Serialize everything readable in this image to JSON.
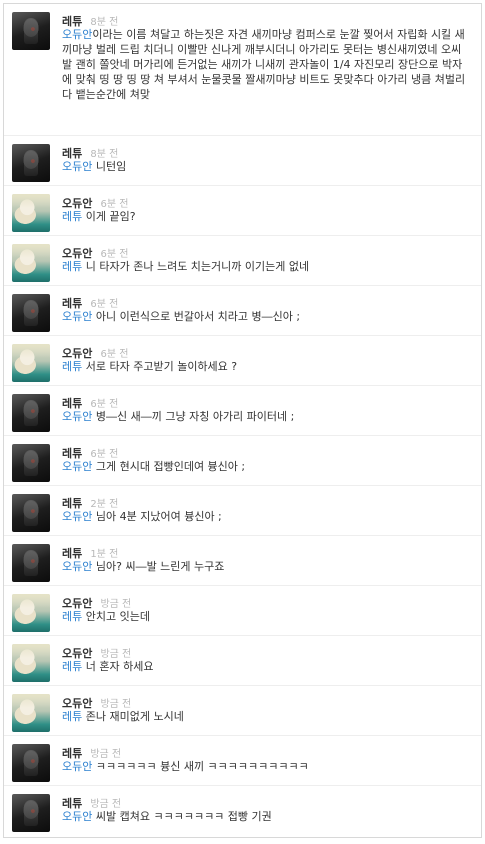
{
  "colors": {
    "mention": "#2a7fcf",
    "time": "#b8b8b8",
    "author": "#333333"
  },
  "comments": [
    {
      "author": "레튜",
      "time": "8분 전",
      "mention": "오듀안",
      "text": "이라는 이름 쳐달고 하는짓은 자견 새끼마냥 컴퍼스로 눈깔 찢어서 자립화 시킬 새끼마냥 벌레 드립 치더니 이빨만 신나게 깨부시더니 아가리도 못터는 병신새끼였네 오씨발 괜히 쫄앗네 머가리에 든거없는 새끼가 니새끼 관자놀이 1/4 자진모리 장단으로 박자에 맞춰 띵 땅 띵 땅 쳐 부셔서 눈물콧물 짤새끼마냥 비트도 못맞추다 아가리 냉큼 쳐벌리다 뱉는순간에 쳐맞",
      "avatar": "dark-avatar-icon"
    },
    {
      "author": "레튜",
      "time": "8분 전",
      "mention": "오듀안",
      "text": " 니턴임",
      "avatar": "dark-avatar-icon"
    },
    {
      "author": "오듀안",
      "time": "6분 전",
      "mention": "레튜",
      "text": " 이게 끝임?",
      "avatar": "light-avatar-icon"
    },
    {
      "author": "오듀안",
      "time": "6분 전",
      "mention": "레튜",
      "text": " 니 타자가 존나 느려도 치는거니까 이기는게 없네",
      "avatar": "light-avatar-icon"
    },
    {
      "author": "레튜",
      "time": "6분 전",
      "mention": "오듀안",
      "text": " 아니 이런식으로 번갈아서 치라고 병―신아 ;",
      "avatar": "dark-avatar-icon"
    },
    {
      "author": "오듀안",
      "time": "6분 전",
      "mention": "레튜",
      "text": " 서로 타자 주고받기 놀이하세요 ?",
      "avatar": "light-avatar-icon"
    },
    {
      "author": "레튜",
      "time": "6분 전",
      "mention": "오듀안",
      "text": " 병―신 새―끼 그냥 자칭 아가리 파이터네 ;",
      "avatar": "dark-avatar-icon"
    },
    {
      "author": "레튜",
      "time": "6분 전",
      "mention": "오듀안",
      "text": " 그게 현시대 접빵인데여 븅신아 ;",
      "avatar": "dark-avatar-icon"
    },
    {
      "author": "레튜",
      "time": "2분 전",
      "mention": "오듀안",
      "text": " 님아 4분 지났어여 븅신아 ;",
      "avatar": "dark-avatar-icon"
    },
    {
      "author": "레튜",
      "time": "1분 전",
      "mention": "오듀안",
      "text": " 님아? 씨―발 느린게 누구죠",
      "avatar": "dark-avatar-icon"
    },
    {
      "author": "오듀안",
      "time": "방금 전",
      "mention": "레튜",
      "text": " 안치고 잇는데",
      "avatar": "light-avatar-icon"
    },
    {
      "author": "오듀안",
      "time": "방금 전",
      "mention": "레튜",
      "text": " 너 혼자 하세요",
      "avatar": "light-avatar-icon"
    },
    {
      "author": "오듀안",
      "time": "방금 전",
      "mention": "레튜",
      "text": " 존나 재미없게 노시네",
      "avatar": "light-avatar-icon"
    },
    {
      "author": "레튜",
      "time": "방금 전",
      "mention": "오듀안",
      "text": " ㅋㅋㅋㅋㅋㅋ 븅신 새끼 ㅋㅋㅋㅋㅋㅋㅋㅋㅋㅋ",
      "avatar": "dark-avatar-icon"
    },
    {
      "author": "레튜",
      "time": "방금 전",
      "mention": "오듀안",
      "text": " 씨발 캡쳐요 ㅋㅋㅋㅋㅋㅋㅋ 접빵 기권",
      "avatar": "dark-avatar-icon"
    }
  ]
}
